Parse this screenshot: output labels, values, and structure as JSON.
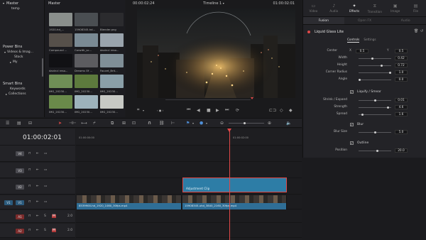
{
  "media_pool": {
    "bins": {
      "master_label": "Master",
      "master_item": "temp",
      "power_bins_label": "Power Bins",
      "power_items": [
        "Videos & Imag...",
        "Stock",
        "My"
      ],
      "smart_bins_label": "Smart Bins",
      "smart_items": [
        "Keywords",
        "Collections"
      ]
    },
    "clips_header": "Master",
    "clips": [
      {
        "label": "1920-hd_...",
        "color": "#8a8f8c"
      },
      {
        "label": "15908345-hd...",
        "color": "#4a4e52"
      },
      {
        "label": "Blender.png",
        "color": "#2b2b2e"
      },
      {
        "label": "Compound ...",
        "color": "#56504a"
      },
      {
        "label": "Corwith_sc...",
        "color": "#7a8a94"
      },
      {
        "label": "davinci reso...",
        "color": "#9aa4ad"
      },
      {
        "label": "davinci reso...",
        "color": "#111114"
      },
      {
        "label": "Dreams Of ...",
        "color": "#5c5c60"
      },
      {
        "label": "Faucet_Brit...",
        "color": "#808f97"
      },
      {
        "label": "IMG_20230...",
        "color": "#6f8e56"
      },
      {
        "label": "IMG_20230...",
        "color": "#5d7a3d"
      },
      {
        "label": "IMG_20230...",
        "color": "#8a9fa8"
      },
      {
        "label": "IMG_20230...",
        "color": "#6a8a4a"
      },
      {
        "label": "IMG_20230...",
        "color": "#9db2bb"
      },
      {
        "label": "IMG_20230...",
        "color": "#c7c9c4"
      }
    ]
  },
  "viewer": {
    "timecode_left": "00:00:02:24",
    "timeline_name": "Timeline 1",
    "timecode_right": "01:00:02:01"
  },
  "inspector": {
    "tabs": [
      {
        "label": "Video",
        "icon": "video-icon"
      },
      {
        "label": "Audio",
        "icon": "audio-icon"
      },
      {
        "label": "Effects",
        "icon": "effects-icon",
        "active": true
      },
      {
        "label": "Transition",
        "icon": "transition-icon"
      },
      {
        "label": "Image",
        "icon": "image-icon"
      },
      {
        "label": "File",
        "icon": "file-icon"
      }
    ],
    "sub_tabs": [
      "Fusion",
      "Open FX",
      "Audio"
    ],
    "effect_name": "Liquid Glass Lite",
    "control_tabs": [
      "Controls",
      "Settings"
    ],
    "center": {
      "label": "Center",
      "x_label": "X",
      "x": "0.5",
      "y_label": "Y",
      "y": "0.5"
    },
    "params": [
      {
        "label": "Width",
        "value": "0.42",
        "pos": 0.42
      },
      {
        "label": "Height",
        "value": "0.72",
        "pos": 0.72
      },
      {
        "label": "Corner Radius",
        "value": "1.0",
        "pos": 1.0
      },
      {
        "label": "Angle",
        "value": "0.0",
        "pos": 0.0
      }
    ],
    "liquify_label": "Liquify / Smear",
    "liquify_params": [
      {
        "label": "Shrink / Expand",
        "value": "0.01",
        "pos": 0.5
      },
      {
        "label": "Strength",
        "value": "4.6",
        "pos": 0.92
      },
      {
        "label": "Spread",
        "value": "1.6",
        "pos": 0.1
      }
    ],
    "blur_label": "Blur",
    "blur_size": {
      "label": "Blur Size",
      "value": "5.0",
      "pos": 0.5
    },
    "outline_label": "Outline",
    "position": {
      "label": "Position",
      "value": "20.0",
      "pos": 0.58
    }
  },
  "timeline": {
    "timecode": "01:00:02:01",
    "ruler": [
      "01:00:00:00",
      "01:00:02:00"
    ],
    "tracks": [
      {
        "id": "V4",
        "type": "video"
      },
      {
        "id": "V3",
        "type": "video"
      },
      {
        "id": "V2",
        "type": "video"
      },
      {
        "id": "V1",
        "type": "video"
      },
      {
        "id": "A1",
        "type": "audio",
        "level": "2.0"
      },
      {
        "id": "A2",
        "type": "audio",
        "level": "2.0"
      }
    ],
    "adjustment_clip_label": "Adjustment Clip",
    "clip_v1_a": "8539900-hd_1920_1080_30fps.mp4",
    "clip_v1_b": "15908345-uhd_3840_2160_30fps.mp4"
  },
  "colors": {
    "accent": "#e04848",
    "adjustment": "#2d7da6",
    "video_clip": "#3d8ab8"
  }
}
